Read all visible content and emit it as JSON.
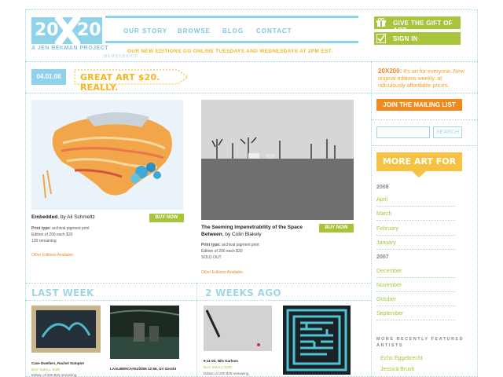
{
  "brand": {
    "logo_left": "20",
    "logo_right": "200",
    "tagline": "A JEN BEKMAN PROJECT"
  },
  "nav": {
    "items": [
      "OUR STORY",
      "BROWSE",
      "BLOG",
      "CONTACT"
    ],
    "announcement": "OUR NEW EDITIONS GO ONLINE TUESDAYS AND WEDNESDAYS AT 2PM EST.",
    "announcement_sub": "MEMBERSHIP"
  },
  "account": {
    "gift_label": "GIVE THE GIFT OF ART",
    "signin_label": "SIGN IN"
  },
  "featured": {
    "date": "04.01.08",
    "tagline": "GREAT ART $20. REALLY."
  },
  "promo": {
    "brand": "20X200:",
    "text": " It's art for everyone. New original editions weekly, at ridiculously affordable prices."
  },
  "artworks": [
    {
      "title": "Embedded",
      "artist": ", by Ali Schmeltz",
      "buy_label": "BUY NOW",
      "print_type_label": "Print type:",
      "print_type": " archival pigment print",
      "edition": "Edition of 200 each $20",
      "status": "120 remaining",
      "other_editions": "Other Editions Available"
    },
    {
      "title": "The Seeming Impenetrability of the Space Between",
      "artist": ", by Colin Blakely",
      "buy_label": "BUY NOW",
      "print_type_label": "Print type:",
      "print_type": " archival pigment print",
      "edition": "Edition of 200 each $20",
      "status": "SOLD OUT",
      "other_editions": "Other Editions Available"
    }
  ],
  "sections": {
    "last_week": "LAST WEEK",
    "two_weeks_ago": "2 WEEKS AGO"
  },
  "small_items": [
    {
      "title": "Cave Dwellers, Rachel Sumpter",
      "link": "BUY SMALL SIZE",
      "meta": "Edition of 200 $20 remaining"
    },
    {
      "title": "LAALBERCA#61/2005 12:56, Ori Gersht",
      "link": "",
      "meta": ""
    },
    {
      "title": "9-11-02, Nils Karlson",
      "link": "BUY SMALL SIZE",
      "meta": "Edition of 200 $20 remaining"
    }
  ],
  "sidebar": {
    "mailing_label": "JOIN THE MAILING LIST",
    "search_placeholder": "",
    "search_button": "SEARCH",
    "more_art": "MORE ART FOR YOU",
    "years": [
      "2008",
      "2007"
    ],
    "months_2008": [
      "April",
      "March",
      "February",
      "January"
    ],
    "months_2007": [
      "December",
      "November",
      "October",
      "September"
    ],
    "featured_heading": "MORE RECENTLY FEATURED ARTISTS",
    "artists": [
      "Echo Eggebrecht",
      "Jessica Brush"
    ]
  }
}
